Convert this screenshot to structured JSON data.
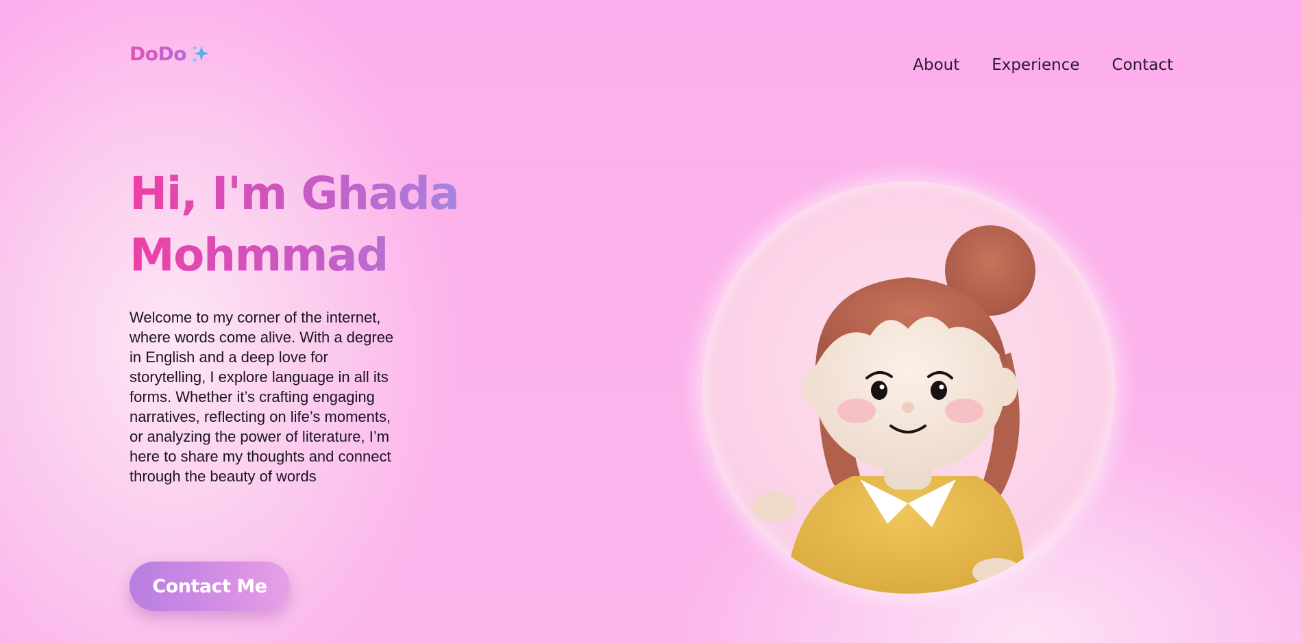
{
  "logo": {
    "text": "DoDo",
    "icon": "sparkle-icon"
  },
  "nav": {
    "items": [
      "About",
      "Experience",
      "Contact"
    ]
  },
  "hero": {
    "title_line1": "Hi, I'm Ghada",
    "title_line2": "Mohmmad",
    "description": "Welcome to my corner of the internet, where words come alive. With a degree in English and a deep love for storytelling, I explore language in all its forms. Whether it’s crafting engaging narratives, reflecting on life’s moments, or analyzing the power of literature, I’m here to share my thoughts and connect through the beauty of words",
    "cta_label": "Contact Me"
  },
  "avatar": {
    "icon": "girl-avatar-illustration"
  },
  "colors": {
    "background": "#fdaeec",
    "accent_pink": "#ee3fa6",
    "accent_purple": "#a08de4",
    "text": "#1c1420"
  }
}
